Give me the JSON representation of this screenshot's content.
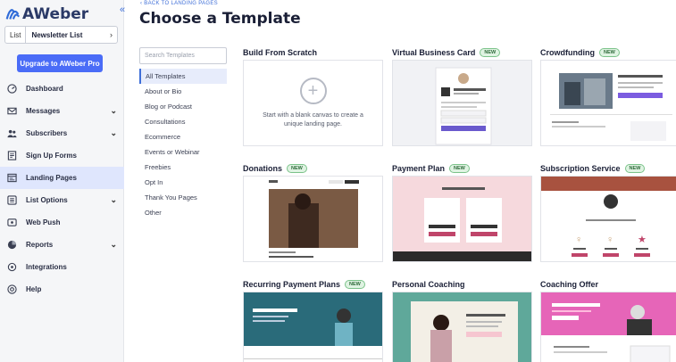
{
  "brand": {
    "name": "AWeber"
  },
  "list": {
    "tag": "List",
    "name": "Newsletter List"
  },
  "upgrade_label": "Upgrade to AWeber Pro",
  "nav": [
    {
      "label": "Dashboard",
      "icon": "dashboard-icon",
      "chev": false,
      "active": false
    },
    {
      "label": "Messages",
      "icon": "envelope-icon",
      "chev": true,
      "active": false
    },
    {
      "label": "Subscribers",
      "icon": "users-icon",
      "chev": true,
      "active": false
    },
    {
      "label": "Sign Up Forms",
      "icon": "form-icon",
      "chev": false,
      "active": false
    },
    {
      "label": "Landing Pages",
      "icon": "landing-page-icon",
      "chev": false,
      "active": true
    },
    {
      "label": "List Options",
      "icon": "list-icon",
      "chev": true,
      "active": false
    },
    {
      "label": "Web Push",
      "icon": "bell-icon",
      "chev": false,
      "active": false
    },
    {
      "label": "Reports",
      "icon": "chart-icon",
      "chev": true,
      "active": false
    },
    {
      "label": "Integrations",
      "icon": "plug-icon",
      "chev": false,
      "active": false
    },
    {
      "label": "Help",
      "icon": "help-icon",
      "chev": false,
      "active": false
    }
  ],
  "back_link": "BACK TO LANDING PAGES",
  "page_title": "Choose a Template",
  "search": {
    "placeholder": "Search Templates"
  },
  "categories": [
    "All Templates",
    "About or Bio",
    "Blog or Podcast",
    "Consultations",
    "Ecommerce",
    "Events or Webinar",
    "Freebies",
    "Opt In",
    "Thank You Pages",
    "Other"
  ],
  "active_category": "All Templates",
  "new_badge": "NEW",
  "templates": [
    {
      "title": "Build From Scratch",
      "new": false,
      "description": "Start with a blank canvas to create a unique landing page."
    },
    {
      "title": "Virtual Business Card",
      "new": true
    },
    {
      "title": "Crowdfunding",
      "new": true
    },
    {
      "title": "Donations",
      "new": true
    },
    {
      "title": "Payment Plan",
      "new": true
    },
    {
      "title": "Subscription Service",
      "new": true
    },
    {
      "title": "Recurring Payment Plans",
      "new": true
    },
    {
      "title": "Personal Coaching",
      "new": false
    },
    {
      "title": "Coaching Offer",
      "new": false
    }
  ],
  "colors": {
    "accent": "#4a6cf7",
    "active_nav": "#dfe6fd",
    "link": "#3f6fd8",
    "badge_bg": "#dff3e2"
  }
}
